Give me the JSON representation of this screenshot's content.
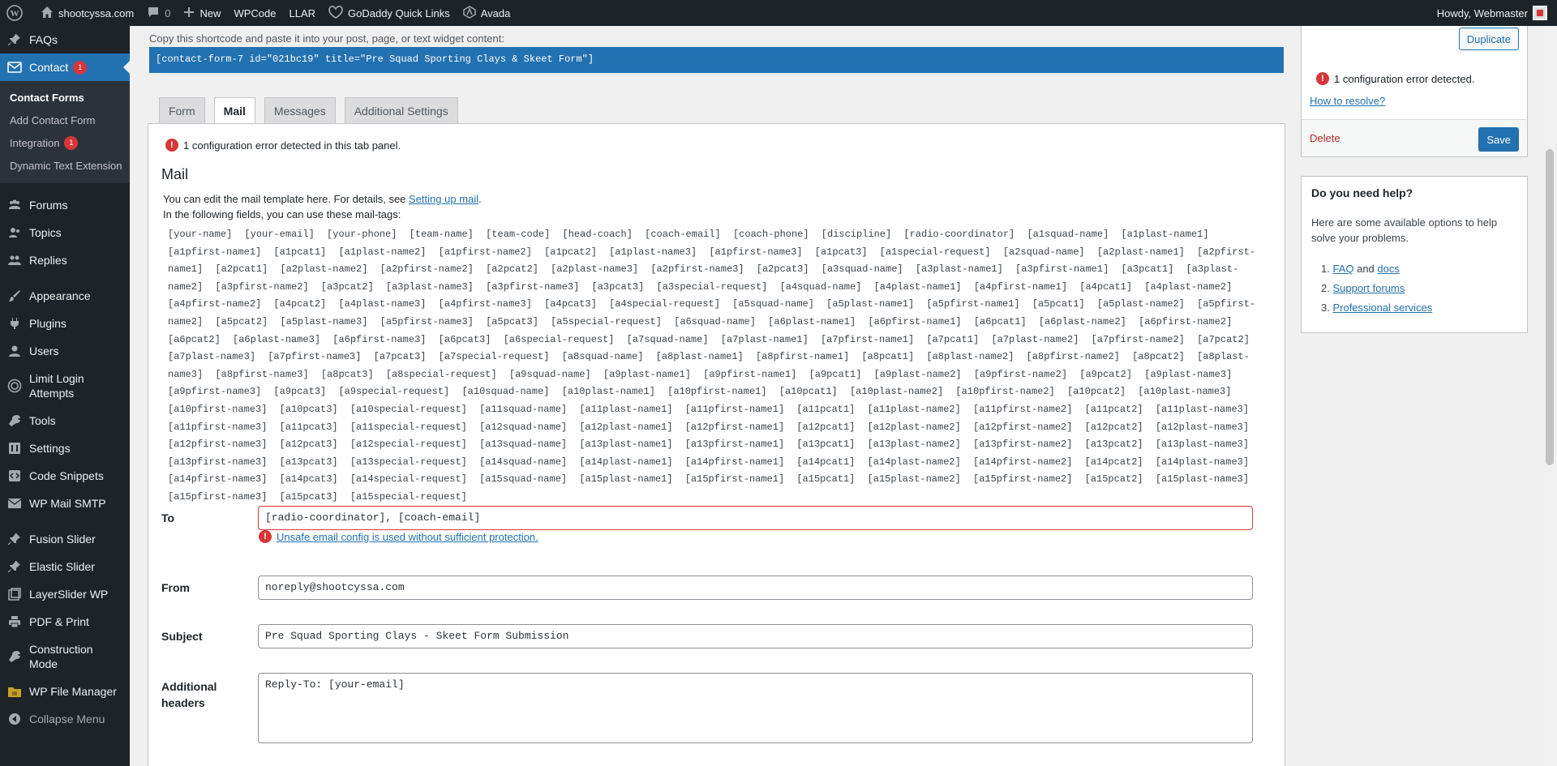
{
  "adminbar": {
    "site_name": "shootcyssa.com",
    "comments_count": "0",
    "new_label": "New",
    "wpcode_label": "WPCode",
    "llar_label": "LLAR",
    "godaddy_label": "GoDaddy Quick Links",
    "avada_label": "Avada",
    "howdy": "Howdy, Webmaster"
  },
  "sidebar": {
    "items": [
      {
        "label": "FAQs",
        "icon": "pin-icon"
      },
      {
        "label": "Contact",
        "icon": "mail-icon",
        "badge": "1"
      },
      {
        "label": "Forums",
        "icon": "forums-icon"
      },
      {
        "label": "Topics",
        "icon": "topics-icon"
      },
      {
        "label": "Replies",
        "icon": "replies-icon"
      },
      {
        "label": "Appearance",
        "icon": "paintbrush-icon"
      },
      {
        "label": "Plugins",
        "icon": "plug-icon"
      },
      {
        "label": "Users",
        "icon": "user-icon"
      },
      {
        "label": "Limit Login Attempts",
        "icon": "shield-icon"
      },
      {
        "label": "Tools",
        "icon": "wrench-icon"
      },
      {
        "label": "Settings",
        "icon": "settings-icon"
      },
      {
        "label": "Code Snippets",
        "icon": "code-icon"
      },
      {
        "label": "WP Mail SMTP",
        "icon": "envelope-icon"
      },
      {
        "label": "Fusion Slider",
        "icon": "pin-icon"
      },
      {
        "label": "Elastic Slider",
        "icon": "pin-icon"
      },
      {
        "label": "LayerSlider WP",
        "icon": "layers-icon"
      },
      {
        "label": "PDF & Print",
        "icon": "printer-icon"
      },
      {
        "label": "Construction Mode",
        "icon": "hammer-icon"
      },
      {
        "label": "WP File Manager",
        "icon": "folder-icon"
      },
      {
        "label": "Collapse Menu",
        "icon": "collapse-icon"
      }
    ],
    "submenu": [
      {
        "label": "Contact Forms"
      },
      {
        "label": "Add Contact Form"
      },
      {
        "label": "Integration",
        "badge": "1"
      },
      {
        "label": "Dynamic Text Extension"
      }
    ]
  },
  "shortcode": {
    "label": "Copy this shortcode and paste it into your post, page, or text widget content:",
    "value": "[contact-form-7 id=\"021bc19\" title=\"Pre Squad Sporting Clays & Skeet Form\"]"
  },
  "tabs": [
    "Form",
    "Mail",
    "Messages",
    "Additional Settings"
  ],
  "panel": {
    "error": "1 configuration error detected in this tab panel.",
    "title": "Mail",
    "desc_prefix": "You can edit the mail template here. For details, see ",
    "desc_link": "Setting up mail",
    "desc_suffix": ".",
    "desc_line2": "In the following fields, you can use these mail-tags:"
  },
  "mailtags": [
    "[your-name]",
    "[your-email]",
    "[your-phone]",
    "[team-name]",
    "[team-code]",
    "[head-coach]",
    "[coach-email]",
    "[coach-phone]",
    "[discipline]",
    "[radio-coordinator]",
    "[a1squad-name]",
    "[a1plast-name1]",
    "[a1pfirst-name1]",
    "[a1pcat1]",
    "[a1plast-name2]",
    "[a1pfirst-name2]",
    "[a1pcat2]",
    "[a1plast-name3]",
    "[a1pfirst-name3]",
    "[a1pcat3]",
    "[a1special-request]",
    "[a2squad-name]",
    "[a2plast-name1]",
    "[a2pfirst-name1]",
    "[a2pcat1]",
    "[a2plast-name2]",
    "[a2pfirst-name2]",
    "[a2pcat2]",
    "[a2plast-name3]",
    "[a2pfirst-name3]",
    "[a2pcat3]",
    "[a3squad-name]",
    "[a3plast-name1]",
    "[a3pfirst-name1]",
    "[a3pcat1]",
    "[a3plast-name2]",
    "[a3pfirst-name2]",
    "[a3pcat2]",
    "[a3plast-name3]",
    "[a3pfirst-name3]",
    "[a3pcat3]",
    "[a3special-request]",
    "[a4squad-name]",
    "[a4plast-name1]",
    "[a4pfirst-name1]",
    "[a4pcat1]",
    "[a4plast-name2]",
    "[a4pfirst-name2]",
    "[a4pcat2]",
    "[a4plast-name3]",
    "[a4pfirst-name3]",
    "[a4pcat3]",
    "[a4special-request]",
    "[a5squad-name]",
    "[a5plast-name1]",
    "[a5pfirst-name1]",
    "[a5pcat1]",
    "[a5plast-name2]",
    "[a5pfirst-name2]",
    "[a5pcat2]",
    "[a5plast-name3]",
    "[a5pfirst-name3]",
    "[a5pcat3]",
    "[a5special-request]",
    "[a6squad-name]",
    "[a6plast-name1]",
    "[a6pfirst-name1]",
    "[a6pcat1]",
    "[a6plast-name2]",
    "[a6pfirst-name2]",
    "[a6pcat2]",
    "[a6plast-name3]",
    "[a6pfirst-name3]",
    "[a6pcat3]",
    "[a6special-request]",
    "[a7squad-name]",
    "[a7plast-name1]",
    "[a7pfirst-name1]",
    "[a7pcat1]",
    "[a7plast-name2]",
    "[a7pfirst-name2]",
    "[a7pcat2]",
    "[a7plast-name3]",
    "[a7pfirst-name3]",
    "[a7pcat3]",
    "[a7special-request]",
    "[a8squad-name]",
    "[a8plast-name1]",
    "[a8pfirst-name1]",
    "[a8pcat1]",
    "[a8plast-name2]",
    "[a8pfirst-name2]",
    "[a8pcat2]",
    "[a8plast-name3]",
    "[a8pfirst-name3]",
    "[a8pcat3]",
    "[a8special-request]",
    "[a9squad-name]",
    "[a9plast-name1]",
    "[a9pfirst-name1]",
    "[a9pcat1]",
    "[a9plast-name2]",
    "[a9pfirst-name2]",
    "[a9pcat2]",
    "[a9plast-name3]",
    "[a9pfirst-name3]",
    "[a9pcat3]",
    "[a9special-request]",
    "[a10squad-name]",
    "[a10plast-name1]",
    "[a10pfirst-name1]",
    "[a10pcat1]",
    "[a10plast-name2]",
    "[a10pfirst-name2]",
    "[a10pcat2]",
    "[a10plast-name3]",
    "[a10pfirst-name3]",
    "[a10pcat3]",
    "[a10special-request]",
    "[a11squad-name]",
    "[a11plast-name1]",
    "[a11pfirst-name1]",
    "[a11pcat1]",
    "[a11plast-name2]",
    "[a11pfirst-name2]",
    "[a11pcat2]",
    "[a11plast-name3]",
    "[a11pfirst-name3]",
    "[a11pcat3]",
    "[a11special-request]",
    "[a12squad-name]",
    "[a12plast-name1]",
    "[a12pfirst-name1]",
    "[a12pcat1]",
    "[a12plast-name2]",
    "[a12pfirst-name2]",
    "[a12pcat2]",
    "[a12plast-name3]",
    "[a12pfirst-name3]",
    "[a12pcat3]",
    "[a12special-request]",
    "[a13squad-name]",
    "[a13plast-name1]",
    "[a13pfirst-name1]",
    "[a13pcat1]",
    "[a13plast-name2]",
    "[a13pfirst-name2]",
    "[a13pcat2]",
    "[a13plast-name3]",
    "[a13pfirst-name3]",
    "[a13pcat3]",
    "[a13special-request]",
    "[a14squad-name]",
    "[a14plast-name1]",
    "[a14pfirst-name1]",
    "[a14pcat1]",
    "[a14plast-name2]",
    "[a14pfirst-name2]",
    "[a14pcat2]",
    "[a14plast-name3]",
    "[a14pfirst-name3]",
    "[a14pcat3]",
    "[a14special-request]",
    "[a15squad-name]",
    "[a15plast-name1]",
    "[a15pfirst-name1]",
    "[a15pcat1]",
    "[a15plast-name2]",
    "[a15pfirst-name2]",
    "[a15pcat2]",
    "[a15plast-name3]",
    "[a15pfirst-name3]",
    "[a15pcat3]",
    "[a15special-request]"
  ],
  "fields": {
    "to_label": "To",
    "to_value": "[radio-coordinator], [coach-email]",
    "to_error": "Unsafe email config is used without sufficient protection.",
    "from_label": "From",
    "from_value": "noreply@shootcyssa.com",
    "subject_label": "Subject",
    "subject_value": "Pre Squad Sporting Clays - Skeet Form Submission",
    "headers_label": "Additional headers",
    "headers_value": "Reply-To: [your-email]"
  },
  "status": {
    "duplicate": "Duplicate",
    "error": "1 configuration error detected.",
    "resolve_link": "How to resolve?",
    "delete": "Delete",
    "save": "Save"
  },
  "help": {
    "title": "Do you need help?",
    "text": "Here are some available options to help solve your problems.",
    "item1_num": "1.",
    "item1_link1": "FAQ",
    "item1_and": " and ",
    "item1_link2": "docs",
    "item2_num": "2.",
    "item2_link": "Support forums",
    "item3_num": "3.",
    "item3_link": "Professional services"
  },
  "colors": {
    "admin_bg": "#1d2327",
    "accent": "#2271b1",
    "error": "#d63638"
  }
}
